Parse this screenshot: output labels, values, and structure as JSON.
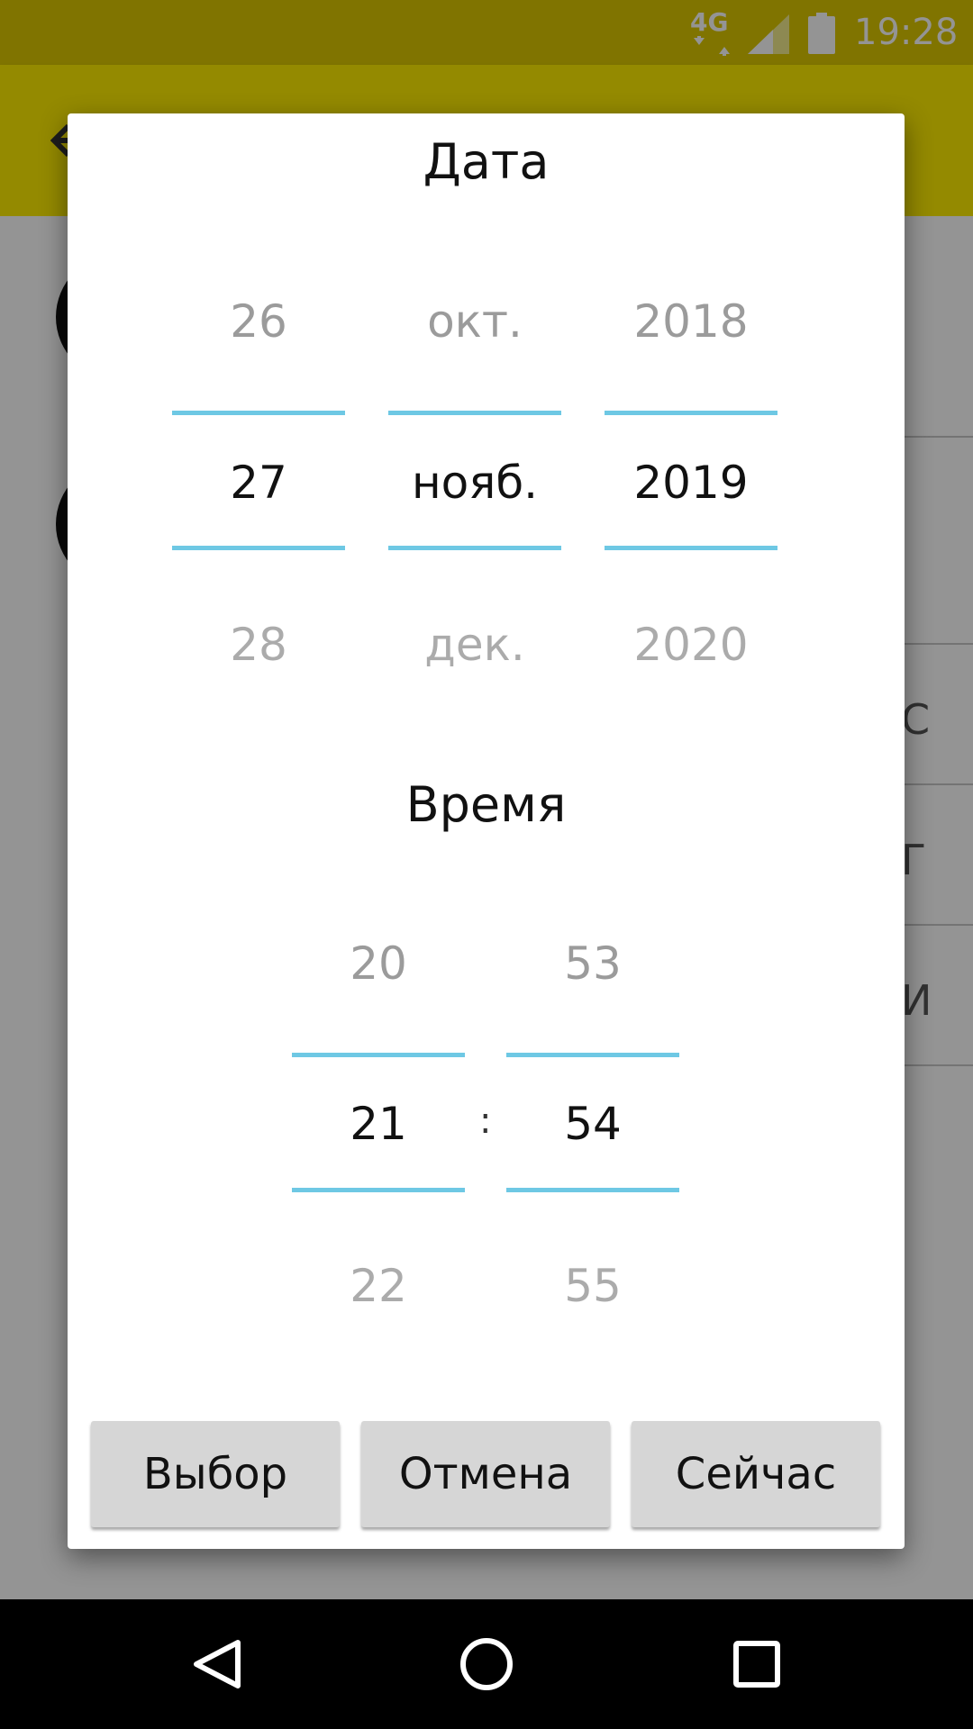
{
  "status_bar": {
    "network": "4G",
    "time": "19:28",
    "icons": [
      "network-4g-icon",
      "signal-icon",
      "battery-icon"
    ]
  },
  "app_bar": {
    "icons": [
      "back-arrow-icon"
    ],
    "color": "#ffee00"
  },
  "background": {
    "letters": [
      "С",
      "Г",
      "И"
    ]
  },
  "dialog": {
    "date_title": "Дата",
    "time_title": "Время",
    "date_picker": {
      "day": {
        "prev": "26",
        "selected": "27",
        "next": "28"
      },
      "month": {
        "prev": "окт.",
        "selected": "нояб.",
        "next": "дек."
      },
      "year": {
        "prev": "2018",
        "selected": "2019",
        "next": "2020"
      }
    },
    "time_picker": {
      "hour": {
        "prev": "20",
        "selected": "21",
        "next": "22"
      },
      "separator": ":",
      "minute": {
        "prev": "53",
        "selected": "54",
        "next": "55"
      }
    },
    "buttons": {
      "select": "Выбор",
      "cancel": "Отмена",
      "now": "Сейчас"
    },
    "accent_color": "#6ec8e4"
  },
  "nav_bar": {
    "icons": [
      "back-icon",
      "home-icon",
      "recents-icon"
    ]
  }
}
